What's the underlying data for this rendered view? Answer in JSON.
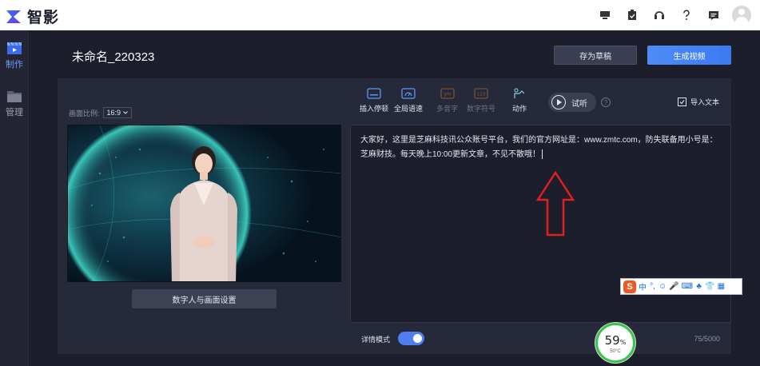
{
  "app": {
    "name": "智影"
  },
  "sidebar": {
    "items": [
      {
        "label": "制作",
        "icon": "clapperboard-icon",
        "active": true
      },
      {
        "label": "管理",
        "icon": "folder-icon",
        "active": false
      }
    ]
  },
  "header": {
    "title": "未命名_220323",
    "save_draft_label": "存为草稿",
    "generate_label": "生成视频"
  },
  "left_panel": {
    "ratio_label": "画面比例:",
    "ratio_value": "16:9",
    "settings_button_label": "数字人与画面设置"
  },
  "toolbar": {
    "tools": [
      {
        "label": "插入停顿",
        "icon": "pause-insert-icon",
        "enabled": true
      },
      {
        "label": "全局语速",
        "icon": "speed-gauge-icon",
        "enabled": true
      },
      {
        "label": "多音字",
        "icon": "pinyin-icon",
        "icon_text": "yin",
        "enabled": false
      },
      {
        "label": "数字符号",
        "icon": "number-symbol-icon",
        "icon_text": "123",
        "enabled": false
      },
      {
        "label": "动作",
        "icon": "gesture-icon",
        "enabled": true
      }
    ],
    "listen_label": "试听",
    "help_symbol": "?",
    "import_label": "导入文本"
  },
  "editor": {
    "text": "大家好，这里是芝麻科技讯公众账号平台，我们的官方网址是：www.zmtc.com，防失联备用小号是：芝麻财技。每天晚上10:00更新文章，不见不散哦！"
  },
  "footer": {
    "detail_mode_label": "详情模式",
    "detail_mode_on": true,
    "char_count": "75/5000"
  },
  "ime": {
    "logo": "S",
    "items": [
      "中",
      "°,",
      "☺",
      "🎤",
      "⌨",
      "♣",
      "👕",
      "▦"
    ]
  },
  "gauge": {
    "percent": "59",
    "percent_unit": "%",
    "temperature": "50°C"
  },
  "colors": {
    "accent": "#4e8cf6",
    "background": "#1c1e2b",
    "panel": "#262939",
    "annotation": "#e02020",
    "gauge_ring": "#38c64a"
  }
}
